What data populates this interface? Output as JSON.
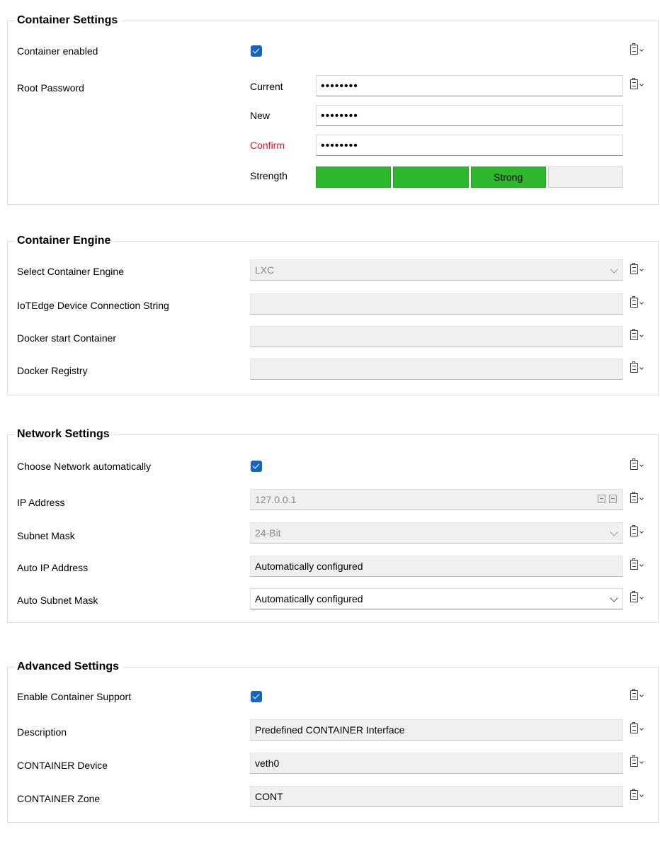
{
  "container_settings": {
    "title": "Container Settings",
    "container_enabled": {
      "label": "Container enabled",
      "checked": true
    },
    "root_password": {
      "label": "Root Password",
      "current_label": "Current",
      "current_value": "••••••••",
      "new_label": "New",
      "new_value": "••••••••",
      "confirm_label": "Confirm",
      "confirm_value": "••••••••",
      "strength_label": "Strength",
      "strength_text": "Strong",
      "strength_level": 0.75
    }
  },
  "container_engine": {
    "title": "Container Engine",
    "select_engine": {
      "label": "Select Container Engine",
      "value": "LXC"
    },
    "iotedge": {
      "label": "IoTEdge Device Connection String",
      "value": ""
    },
    "docker_start": {
      "label": "Docker start Container",
      "value": ""
    },
    "docker_registry": {
      "label": "Docker Registry",
      "value": ""
    }
  },
  "network_settings": {
    "title": "Network Settings",
    "choose_auto": {
      "label": "Choose Network automatically",
      "checked": true
    },
    "ip_address": {
      "label": "IP Address",
      "value": "127.0.0.1"
    },
    "subnet_mask": {
      "label": "Subnet Mask",
      "value": "24-Bit"
    },
    "auto_ip": {
      "label": "Auto IP Address",
      "value": "Automatically configured"
    },
    "auto_subnet": {
      "label": "Auto Subnet Mask",
      "value": "Automatically configured"
    }
  },
  "advanced_settings": {
    "title": "Advanced Settings",
    "enable_support": {
      "label": "Enable Container Support",
      "checked": true
    },
    "description": {
      "label": "Description",
      "value": "Predefined CONTAINER Interface"
    },
    "device": {
      "label": "CONTAINER Device",
      "value": "veth0"
    },
    "zone": {
      "label": "CONTAINER Zone",
      "value": "CONT"
    }
  },
  "colors": {
    "checkbox": "#1565c0",
    "strength_on": "#2eb82e",
    "confirm_label": "#e81123"
  },
  "icons": {
    "clipboard": "clipboard-dropdown-icon",
    "checkbox": "checkmark-icon"
  }
}
